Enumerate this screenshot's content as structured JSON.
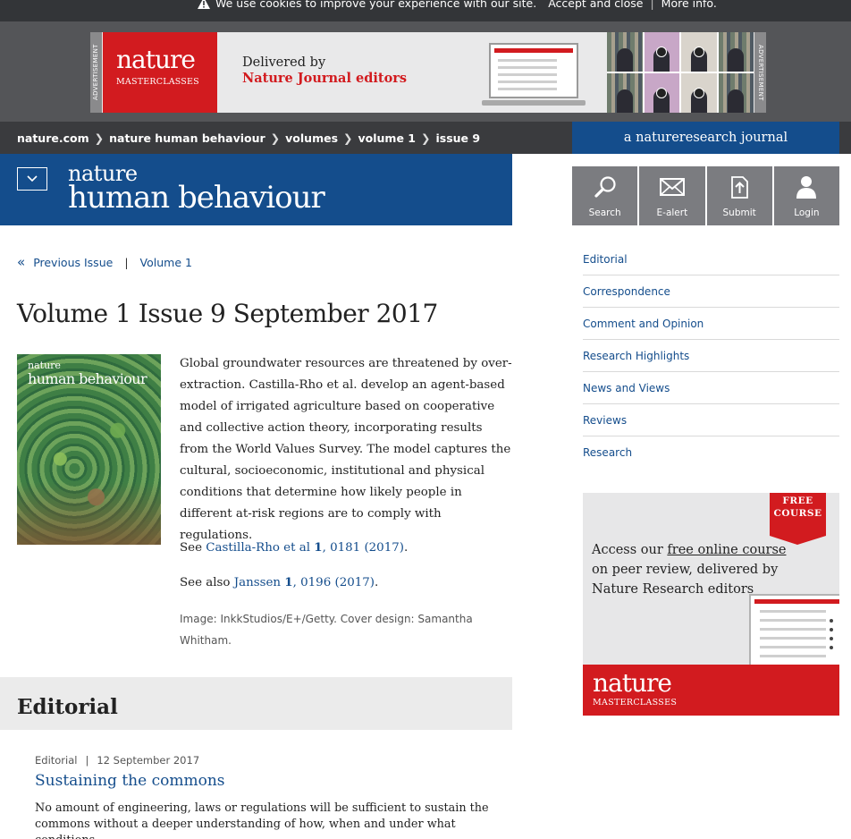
{
  "cookie_bar": {
    "message": "We use cookies to improve your experience with our site.",
    "accept": "Accept and close",
    "more": "More info."
  },
  "top_ad": {
    "side_label": "ADVERTISEMENT",
    "logo_word": "nature",
    "logo_sub": "MASTERCLASSES",
    "line1": "Delivered by",
    "line2": "Nature Journal editors"
  },
  "breadcrumb": [
    "nature.com",
    "nature human behaviour",
    "volumes",
    "volume 1",
    "issue 9"
  ],
  "nr_banner": "a natureresearch journal",
  "masthead": {
    "nature": "nature",
    "title": "human behaviour"
  },
  "tools": [
    {
      "label": "Search",
      "icon": "search-icon"
    },
    {
      "label": "E-alert",
      "icon": "mail-icon"
    },
    {
      "label": "Submit",
      "icon": "upload-icon"
    },
    {
      "label": "Login",
      "icon": "user-icon"
    }
  ],
  "issue_nav": {
    "previous": "Previous Issue",
    "volume": "Volume 1"
  },
  "issue": {
    "title": "Volume 1 Issue 9 September 2017",
    "cover_nature": "nature",
    "cover_title": "human behaviour",
    "description": "Global groundwater resources are threatened by over-extraction. Castilla-Rho et al. develop an agent-based model of irrigated agriculture based on cooperative and collective action theory, incorporating results from the World Values Survey. The model captures the cultural, socioeconomic, institutional and physical conditions that determine how likely people in different at-risk regions are to comply with regulations.",
    "see1_prefix": "See",
    "see1_link_a": "Castilla-Rho et al",
    "see1_vol": "1",
    "see1_link_b": ", 0181 (2017)",
    "see1_suffix": ".",
    "see2_prefix": "See also",
    "see2_link_a": "Janssen",
    "see2_vol": "1",
    "see2_link_b": ", 0196 (2017)",
    "see2_suffix": ".",
    "credit": "Image: InkkStudios/E+/Getty. Cover design: Samantha Whitham."
  },
  "sidebar_nav": [
    "Editorial",
    "Correspondence",
    "Comment and Opinion",
    "Research Highlights",
    "News and Views",
    "Reviews",
    "Research"
  ],
  "side_ad": {
    "badge_line1": "FREE",
    "badge_line2": "COURSE",
    "text_prefix": "Access our ",
    "text_link": "free online course",
    "text_rest": " on peer review, delivered by Nature Research editors",
    "logo_word": "nature",
    "logo_sub": "MASTERCLASSES"
  },
  "section": {
    "heading": "Editorial",
    "article": {
      "type": "Editorial",
      "date": "12 September 2017",
      "title": "Sustaining the commons",
      "excerpt": "No amount of engineering, laws or regulations will be sufficient to sustain the commons without a deeper understanding of how, when and under what conditions"
    }
  },
  "colors": {
    "brand_blue": "#144d8c",
    "nature_red": "#d21b1f",
    "dark_bar": "#3a3b3e"
  }
}
